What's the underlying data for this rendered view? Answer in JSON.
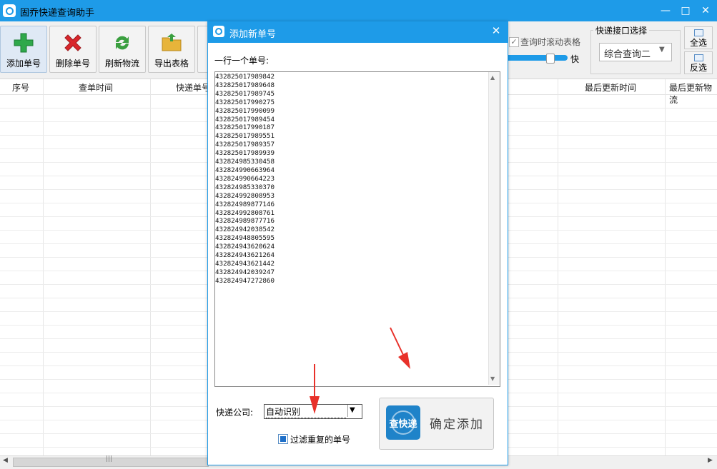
{
  "window": {
    "title": "固乔快递查询助手"
  },
  "toolbar": {
    "buttons": [
      {
        "label": "添加单号",
        "icon": "plus-icon"
      },
      {
        "label": "删除单号",
        "icon": "delete-x-icon"
      },
      {
        "label": "刷新物流",
        "icon": "refresh-icon"
      },
      {
        "label": "导出表格",
        "icon": "folder-export-icon"
      }
    ],
    "scroll_checkbox": {
      "label": "查询时滚动表格",
      "checked": true
    },
    "speed_label": "快",
    "speed_value": 0.73,
    "api_group": {
      "legend": "快递接口选择",
      "selected": "综合查询二"
    },
    "select_all_label": "全选",
    "invert_label": "反选"
  },
  "table": {
    "columns": [
      "序号",
      "查单时间",
      "快递单号",
      "最后更新时间",
      "最后更新物流"
    ]
  },
  "dialog": {
    "title": "添加新单号",
    "instruction": "一行一个单号:",
    "tracking_numbers": [
      "432825017989842",
      "432825017989648",
      "432825017989745",
      "432825017990275",
      "432825017990099",
      "432825017989454",
      "432825017990187",
      "432825017989551",
      "432825017989357",
      "432825017989939",
      "432824985330458",
      "432824990663964",
      "432824990664223",
      "432824985330370",
      "432824992808953",
      "432824989877146",
      "432824992808761",
      "432824989877716",
      "432824942038542",
      "432824948805595",
      "432824943620624",
      "432824943621264",
      "432824943621442",
      "432824942039247",
      "432824947272860"
    ],
    "company_label": "快递公司:",
    "company_value": "自动识别",
    "filter_label": "过滤重复的单号",
    "filter_checked": true,
    "confirm_label": "确定添加",
    "confirm_icon_text": "查快递"
  },
  "colors": {
    "accent": "#1e9be8",
    "arrow": "#e8312a"
  }
}
